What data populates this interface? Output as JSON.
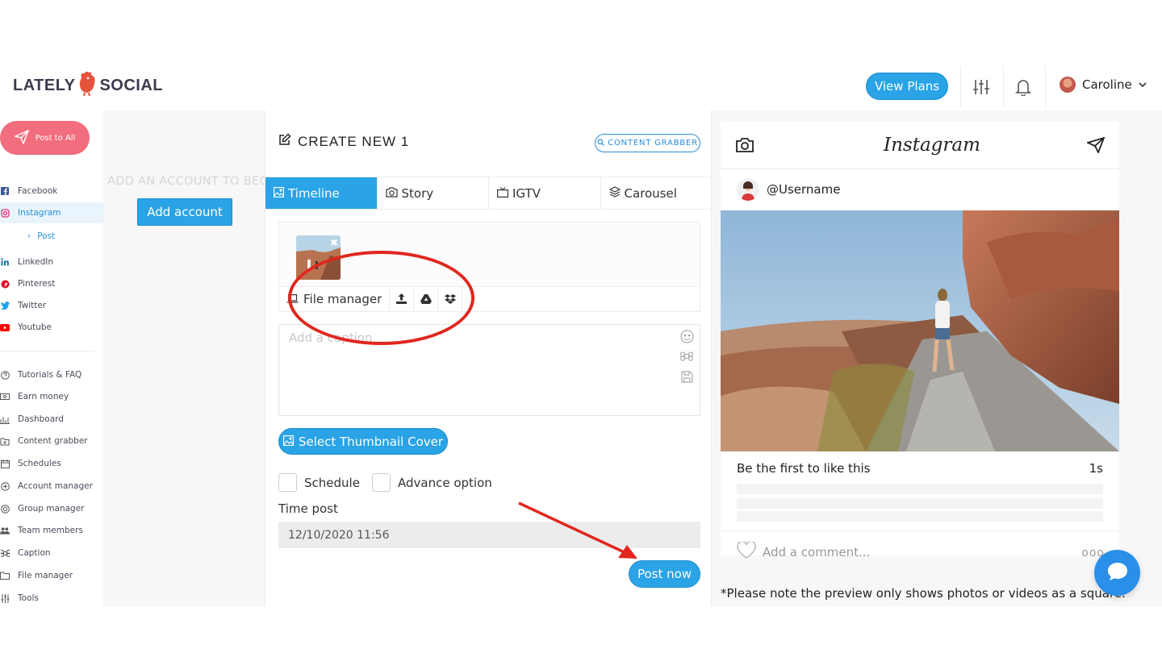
{
  "header": {
    "logo_left": "LATELY",
    "logo_right": "SOCIAL",
    "view_plans": "View Plans",
    "user_name": "Caroline"
  },
  "sidebar": {
    "post_to_all": "Post to All",
    "networks": [
      {
        "label": "Facebook",
        "icon": "facebook-icon",
        "color": "#3b5998"
      },
      {
        "label": "Instagram",
        "icon": "instagram-icon",
        "color": "#e1306c"
      },
      {
        "label": "LinkedIn",
        "icon": "linkedin-icon",
        "color": "#0e76a8"
      },
      {
        "label": "Pinterest",
        "icon": "pinterest-icon",
        "color": "#e60023"
      },
      {
        "label": "Twitter",
        "icon": "twitter-icon",
        "color": "#1da1f2"
      },
      {
        "label": "Youtube",
        "icon": "youtube-icon",
        "color": "#ff0000"
      }
    ],
    "instagram_sub": "Post",
    "tools": [
      {
        "label": "Tutorials & FAQ",
        "icon": "help-icon"
      },
      {
        "label": "Earn money",
        "icon": "money-icon"
      },
      {
        "label": "Dashboard",
        "icon": "chart-icon"
      },
      {
        "label": "Content grabber",
        "icon": "grabber-icon"
      },
      {
        "label": "Schedules",
        "icon": "calendar-icon"
      },
      {
        "label": "Account manager",
        "icon": "account-icon"
      },
      {
        "label": "Group manager",
        "icon": "group-icon"
      },
      {
        "label": "Team members",
        "icon": "team-icon"
      },
      {
        "label": "Caption",
        "icon": "caption-icon"
      },
      {
        "label": "File manager",
        "icon": "folder-icon"
      },
      {
        "label": "Tools",
        "icon": "tools-icon"
      }
    ]
  },
  "accounts": {
    "empty_text": "ADD AN ACCOUNT TO BEGIN",
    "add_account": "Add account"
  },
  "editor": {
    "title": "CREATE NEW 1",
    "content_grabber": "CONTENT GRABBER",
    "tabs": [
      {
        "label": "Timeline",
        "icon": "image-icon"
      },
      {
        "label": "Story",
        "icon": "camera-icon"
      },
      {
        "label": "IGTV",
        "icon": "tv-icon"
      },
      {
        "label": "Carousel",
        "icon": "layers-icon"
      }
    ],
    "file_manager": "File manager",
    "caption_placeholder": "Add a caption",
    "select_thumbnail": "Select Thumbnail Cover",
    "schedule": "Schedule",
    "advance_option": "Advance option",
    "time_post_label": "Time post",
    "time_post_value": "12/10/2020 11:56",
    "post_now": "Post now"
  },
  "preview": {
    "brand": "Instagram",
    "username": "@Username",
    "likes_text": "Be the first to like this",
    "time": "1s",
    "comment_placeholder": "Add a comment...",
    "dots": "ooo",
    "note": "*Please note the preview only shows photos or videos as a square."
  }
}
